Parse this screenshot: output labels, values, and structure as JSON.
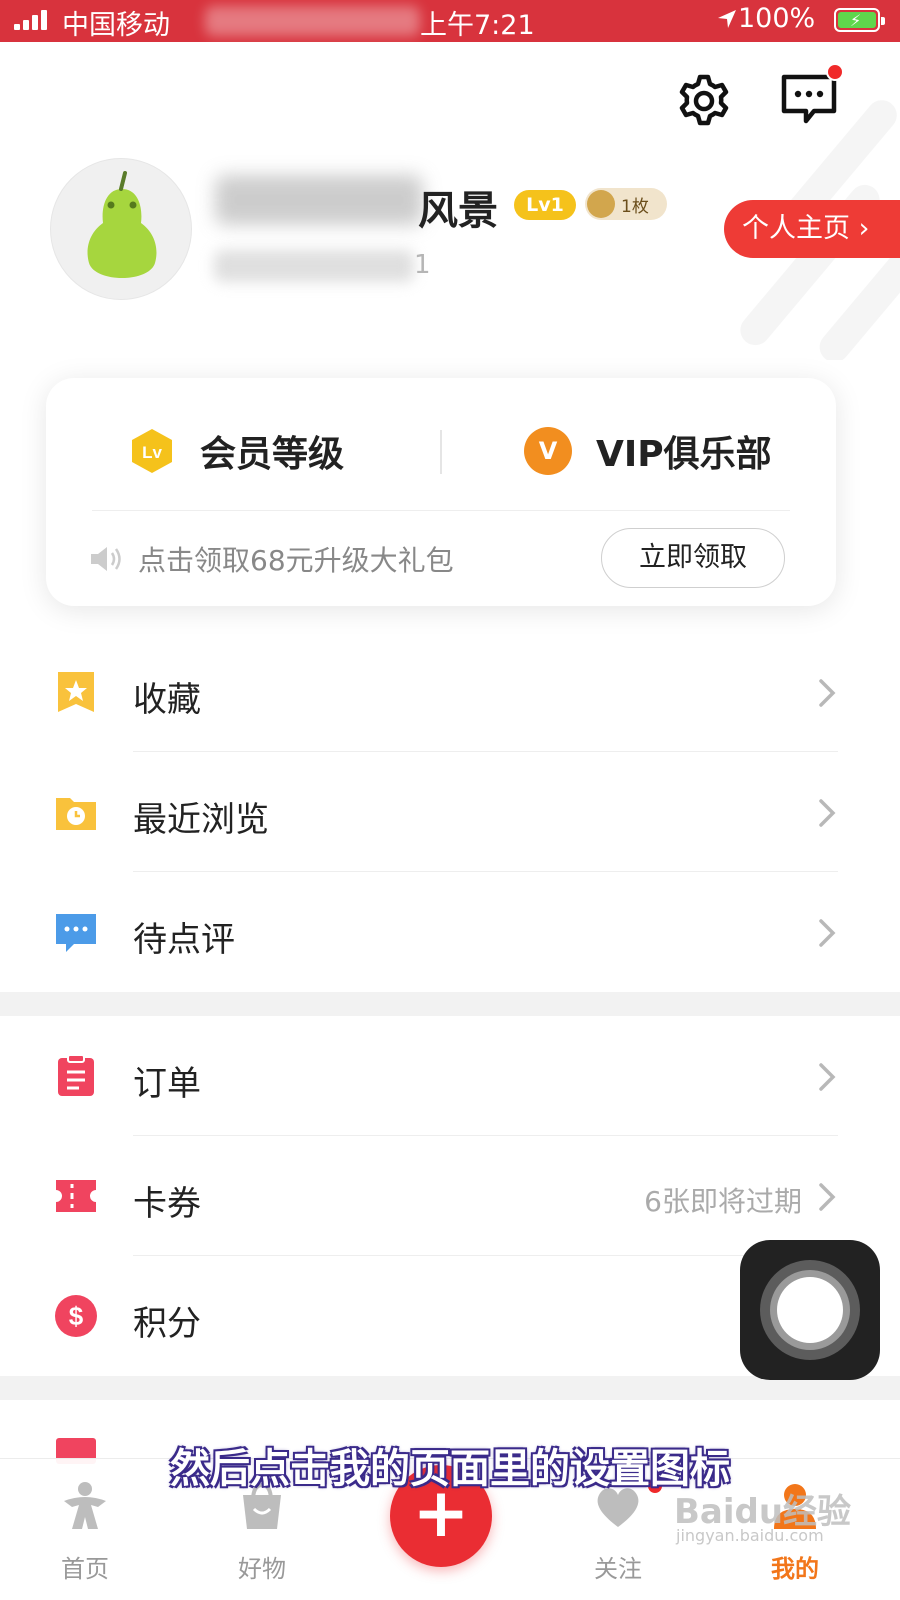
{
  "status_bar": {
    "carrier": "中国移动",
    "time": "上午7:21",
    "battery": "100%"
  },
  "profile": {
    "username_visible": "风景",
    "level_badge": "Lv1",
    "medal_count": "1枚",
    "stats_visible": "1",
    "homepage_button": "个人主页"
  },
  "member_card": {
    "level_label": "会员等级",
    "level_icon_text": "Lv",
    "vip_label": "VIP俱乐部",
    "vip_icon_text": "V",
    "promo_text": "点击领取68元升级大礼包",
    "claim_button": "立即领取"
  },
  "menu_group_1": [
    {
      "label": "收藏",
      "icon": "star-bookmark-icon",
      "color": "#f9c23c"
    },
    {
      "label": "最近浏览",
      "icon": "clock-folder-icon",
      "color": "#f9c23c"
    },
    {
      "label": "待点评",
      "icon": "chat-bubble-icon",
      "color": "#4c9be8"
    }
  ],
  "menu_group_2": [
    {
      "label": "订单",
      "icon": "clipboard-icon",
      "color": "#f0445f"
    },
    {
      "label": "卡券",
      "icon": "ticket-icon",
      "color": "#f0445f"
    },
    {
      "label": "积分",
      "icon": "dollar-coin-icon",
      "color": "#f0445f",
      "right_text": ""
    }
  ],
  "coupon_note": "6张即将过期",
  "subtitle": "然后点击我的页面里的设置图标",
  "bottom_nav": [
    {
      "label": "首页",
      "icon": "home-person-icon"
    },
    {
      "label": "好物",
      "icon": "shopping-bag-icon"
    },
    {
      "label": "",
      "icon": "plus-icon"
    },
    {
      "label": "关注",
      "icon": "heart-icon"
    },
    {
      "label": "我的",
      "icon": "user-icon"
    }
  ],
  "watermark": {
    "main": "Baidu经验",
    "sub": "jingyan.baidu.com"
  },
  "colors": {
    "status_bar": "#d8333d",
    "accent_red": "#ee3b36",
    "active_tab": "#f2761a",
    "lv_badge": "#f5c21b",
    "vip_coin": "#f28e1f"
  }
}
